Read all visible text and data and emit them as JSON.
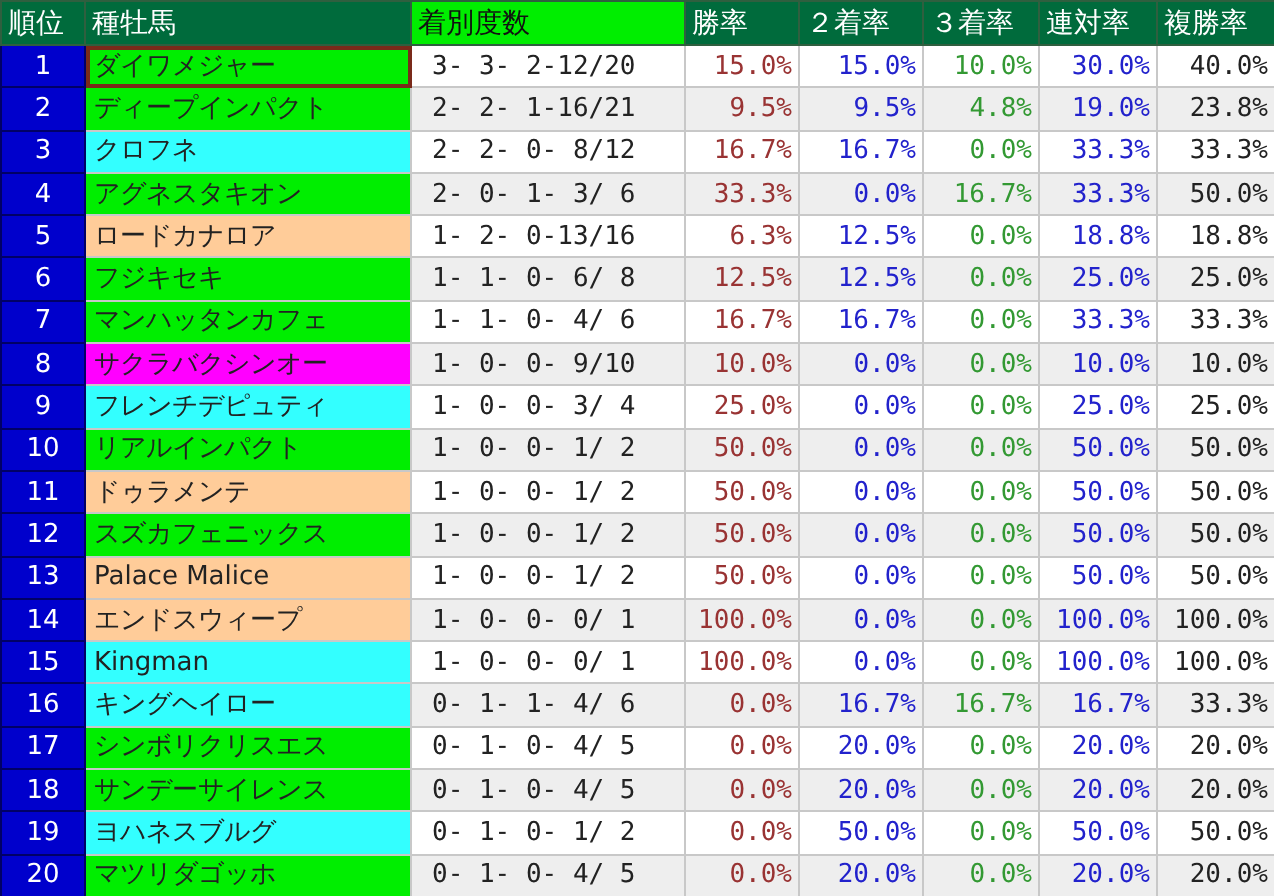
{
  "table": {
    "columns": [
      {
        "label": "順位",
        "kind": "rank"
      },
      {
        "label": "種牡馬",
        "kind": "name"
      },
      {
        "label": "着別度数",
        "kind": "record"
      },
      {
        "label": "勝率",
        "kind": "win"
      },
      {
        "label": "２着率",
        "kind": "second"
      },
      {
        "label": "３着率",
        "kind": "third"
      },
      {
        "label": "連対率",
        "kind": "quinella"
      },
      {
        "label": "複勝率",
        "kind": "show"
      }
    ],
    "rows": [
      {
        "rank": "1",
        "name": "ダイワメジャー",
        "color": "#00ee00",
        "selected": true,
        "record": "3- 3- 2-12/20",
        "win": "15.0%",
        "second": "15.0%",
        "third": "10.0%",
        "quinella": "30.0%",
        "show": "40.0%"
      },
      {
        "rank": "2",
        "name": "ディープインパクト",
        "color": "#00ee00",
        "selected": false,
        "record": "2- 2- 1-16/21",
        "win": "9.5%",
        "second": "9.5%",
        "third": "4.8%",
        "quinella": "19.0%",
        "show": "23.8%"
      },
      {
        "rank": "3",
        "name": "クロフネ",
        "color": "#33ffff",
        "selected": false,
        "record": "2- 2- 0- 8/12",
        "win": "16.7%",
        "second": "16.7%",
        "third": "0.0%",
        "quinella": "33.3%",
        "show": "33.3%"
      },
      {
        "rank": "4",
        "name": "アグネスタキオン",
        "color": "#00ee00",
        "selected": false,
        "record": "2- 0- 1- 3/ 6",
        "win": "33.3%",
        "second": "0.0%",
        "third": "16.7%",
        "quinella": "33.3%",
        "show": "50.0%"
      },
      {
        "rank": "5",
        "name": "ロードカナロア",
        "color": "#ffcc99",
        "selected": false,
        "record": "1- 2- 0-13/16",
        "win": "6.3%",
        "second": "12.5%",
        "third": "0.0%",
        "quinella": "18.8%",
        "show": "18.8%"
      },
      {
        "rank": "6",
        "name": "フジキセキ",
        "color": "#00ee00",
        "selected": false,
        "record": "1- 1- 0- 6/ 8",
        "win": "12.5%",
        "second": "12.5%",
        "third": "0.0%",
        "quinella": "25.0%",
        "show": "25.0%"
      },
      {
        "rank": "7",
        "name": "マンハッタンカフェ",
        "color": "#00ee00",
        "selected": false,
        "record": "1- 1- 0- 4/ 6",
        "win": "16.7%",
        "second": "16.7%",
        "third": "0.0%",
        "quinella": "33.3%",
        "show": "33.3%"
      },
      {
        "rank": "8",
        "name": "サクラバクシンオー",
        "color": "#ff00ff",
        "selected": false,
        "record": "1- 0- 0- 9/10",
        "win": "10.0%",
        "second": "0.0%",
        "third": "0.0%",
        "quinella": "10.0%",
        "show": "10.0%"
      },
      {
        "rank": "9",
        "name": "フレンチデピュティ",
        "color": "#33ffff",
        "selected": false,
        "record": "1- 0- 0- 3/ 4",
        "win": "25.0%",
        "second": "0.0%",
        "third": "0.0%",
        "quinella": "25.0%",
        "show": "25.0%"
      },
      {
        "rank": "10",
        "name": "リアルインパクト",
        "color": "#00ee00",
        "selected": false,
        "record": "1- 0- 0- 1/ 2",
        "win": "50.0%",
        "second": "0.0%",
        "third": "0.0%",
        "quinella": "50.0%",
        "show": "50.0%"
      },
      {
        "rank": "11",
        "name": "ドゥラメンテ",
        "color": "#ffcc99",
        "selected": false,
        "record": "1- 0- 0- 1/ 2",
        "win": "50.0%",
        "second": "0.0%",
        "third": "0.0%",
        "quinella": "50.0%",
        "show": "50.0%"
      },
      {
        "rank": "12",
        "name": "スズカフェニックス",
        "color": "#00ee00",
        "selected": false,
        "record": "1- 0- 0- 1/ 2",
        "win": "50.0%",
        "second": "0.0%",
        "third": "0.0%",
        "quinella": "50.0%",
        "show": "50.0%"
      },
      {
        "rank": "13",
        "name": "Palace Malice",
        "color": "#ffcc99",
        "selected": false,
        "record": "1- 0- 0- 1/ 2",
        "win": "50.0%",
        "second": "0.0%",
        "third": "0.0%",
        "quinella": "50.0%",
        "show": "50.0%"
      },
      {
        "rank": "14",
        "name": "エンドスウィープ",
        "color": "#ffcc99",
        "selected": false,
        "record": "1- 0- 0- 0/ 1",
        "win": "100.0%",
        "second": "0.0%",
        "third": "0.0%",
        "quinella": "100.0%",
        "show": "100.0%"
      },
      {
        "rank": "15",
        "name": "Kingman",
        "color": "#33ffff",
        "selected": false,
        "record": "1- 0- 0- 0/ 1",
        "win": "100.0%",
        "second": "0.0%",
        "third": "0.0%",
        "quinella": "100.0%",
        "show": "100.0%"
      },
      {
        "rank": "16",
        "name": "キングヘイロー",
        "color": "#33ffff",
        "selected": false,
        "record": "0- 1- 1- 4/ 6",
        "win": "0.0%",
        "second": "16.7%",
        "third": "16.7%",
        "quinella": "16.7%",
        "show": "33.3%"
      },
      {
        "rank": "17",
        "name": "シンボリクリスエス",
        "color": "#00ee00",
        "selected": false,
        "record": "0- 1- 0- 4/ 5",
        "win": "0.0%",
        "second": "20.0%",
        "third": "0.0%",
        "quinella": "20.0%",
        "show": "20.0%"
      },
      {
        "rank": "18",
        "name": "サンデーサイレンス",
        "color": "#00ee00",
        "selected": false,
        "record": "0- 1- 0- 4/ 5",
        "win": "0.0%",
        "second": "20.0%",
        "third": "0.0%",
        "quinella": "20.0%",
        "show": "20.0%"
      },
      {
        "rank": "19",
        "name": "ヨハネスブルグ",
        "color": "#33ffff",
        "selected": false,
        "record": "0- 1- 0- 1/ 2",
        "win": "0.0%",
        "second": "50.0%",
        "third": "0.0%",
        "quinella": "50.0%",
        "show": "50.0%"
      },
      {
        "rank": "20",
        "name": "マツリダゴッホ",
        "color": "#00ee00",
        "selected": false,
        "record": "0- 1- 0- 4/ 5",
        "win": "0.0%",
        "second": "20.0%",
        "third": "0.0%",
        "quinella": "20.0%",
        "show": "20.0%"
      }
    ]
  }
}
